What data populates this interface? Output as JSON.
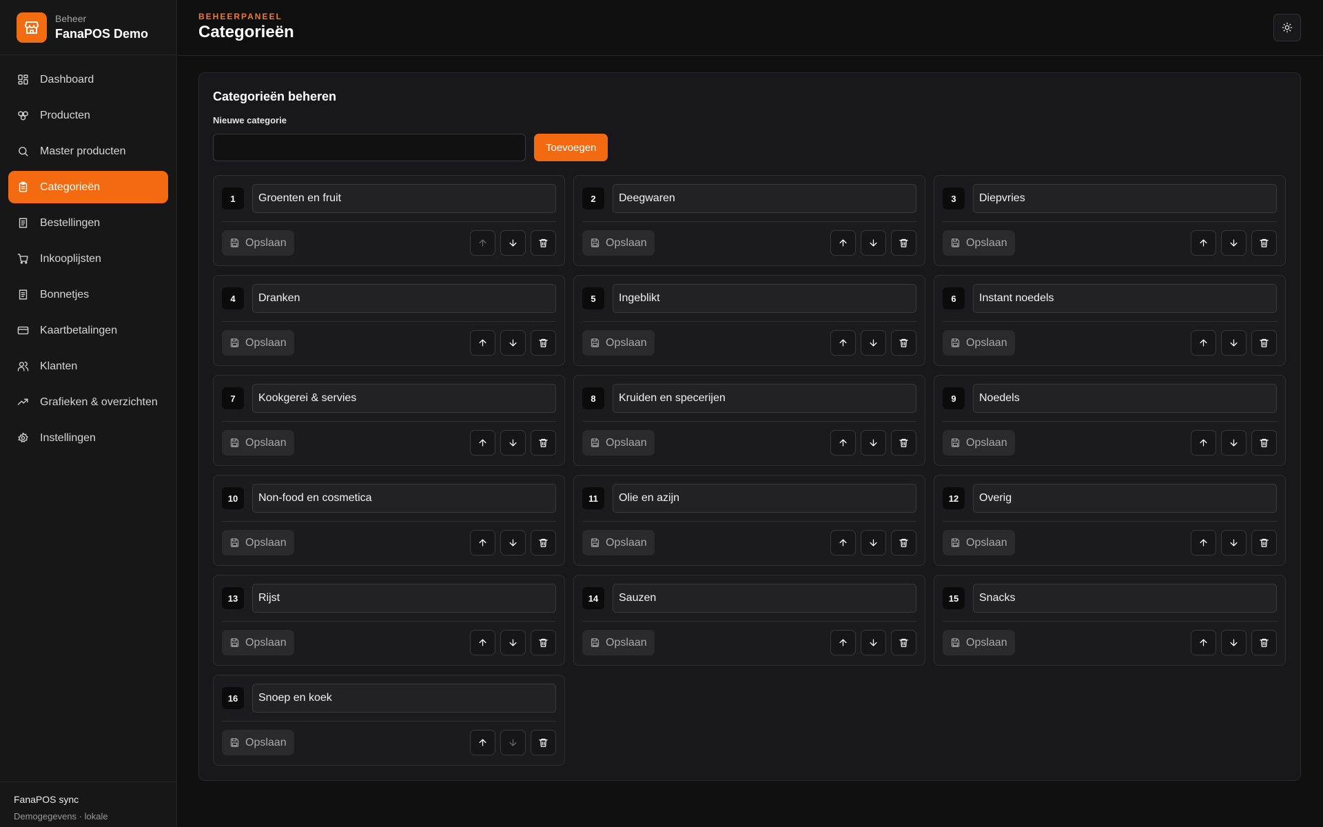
{
  "brand": {
    "small": "Beheer",
    "name": "FanaPOS Demo",
    "logo_icon": "store-icon",
    "accent": "#f46a10"
  },
  "sidebar": {
    "items": [
      {
        "label": "Dashboard",
        "icon": "dashboard-icon",
        "active": false
      },
      {
        "label": "Producten",
        "icon": "boxes-icon",
        "active": false
      },
      {
        "label": "Master producten",
        "icon": "search-icon",
        "active": false
      },
      {
        "label": "Categorieën",
        "icon": "clipboard-icon",
        "active": true
      },
      {
        "label": "Bestellingen",
        "icon": "receipt-icon",
        "active": false
      },
      {
        "label": "Inkooplijsten",
        "icon": "cart-icon",
        "active": false
      },
      {
        "label": "Bonnetjes",
        "icon": "receipt-icon",
        "active": false
      },
      {
        "label": "Kaartbetalingen",
        "icon": "credit-card-icon",
        "active": false
      },
      {
        "label": "Klanten",
        "icon": "users-icon",
        "active": false
      },
      {
        "label": "Grafieken & overzichten",
        "icon": "trend-icon",
        "active": false
      },
      {
        "label": "Instellingen",
        "icon": "gear-icon",
        "active": false
      }
    ],
    "footer": {
      "title": "FanaPOS sync",
      "subtitle": "Demogegevens · lokale"
    }
  },
  "header": {
    "eyebrow": "BEHEERPANEEL",
    "title": "Categorieën",
    "theme_icon": "sun-icon"
  },
  "panel": {
    "title": "Categorieën beheren",
    "new_label": "Nieuwe categorie",
    "new_value": "",
    "add_label": "Toevoegen",
    "save_label": "Opslaan"
  },
  "categories": [
    {
      "num": "1",
      "name": "Groenten en fruit",
      "up_disabled": true,
      "down_disabled": false
    },
    {
      "num": "2",
      "name": "Deegwaren",
      "up_disabled": false,
      "down_disabled": false
    },
    {
      "num": "3",
      "name": "Diepvries",
      "up_disabled": false,
      "down_disabled": false
    },
    {
      "num": "4",
      "name": "Dranken",
      "up_disabled": false,
      "down_disabled": false
    },
    {
      "num": "5",
      "name": "Ingeblikt",
      "up_disabled": false,
      "down_disabled": false
    },
    {
      "num": "6",
      "name": "Instant noedels",
      "up_disabled": false,
      "down_disabled": false
    },
    {
      "num": "7",
      "name": "Kookgerei & servies",
      "up_disabled": false,
      "down_disabled": false
    },
    {
      "num": "8",
      "name": "Kruiden en specerijen",
      "up_disabled": false,
      "down_disabled": false
    },
    {
      "num": "9",
      "name": "Noedels",
      "up_disabled": false,
      "down_disabled": false
    },
    {
      "num": "10",
      "name": "Non-food en cosmetica",
      "up_disabled": false,
      "down_disabled": false
    },
    {
      "num": "11",
      "name": "Olie en azijn",
      "up_disabled": false,
      "down_disabled": false
    },
    {
      "num": "12",
      "name": "Overig",
      "up_disabled": false,
      "down_disabled": false
    },
    {
      "num": "13",
      "name": "Rijst",
      "up_disabled": false,
      "down_disabled": false
    },
    {
      "num": "14",
      "name": "Sauzen",
      "up_disabled": false,
      "down_disabled": false
    },
    {
      "num": "15",
      "name": "Snacks",
      "up_disabled": false,
      "down_disabled": false
    },
    {
      "num": "16",
      "name": "Snoep en koek",
      "up_disabled": false,
      "down_disabled": true
    }
  ]
}
